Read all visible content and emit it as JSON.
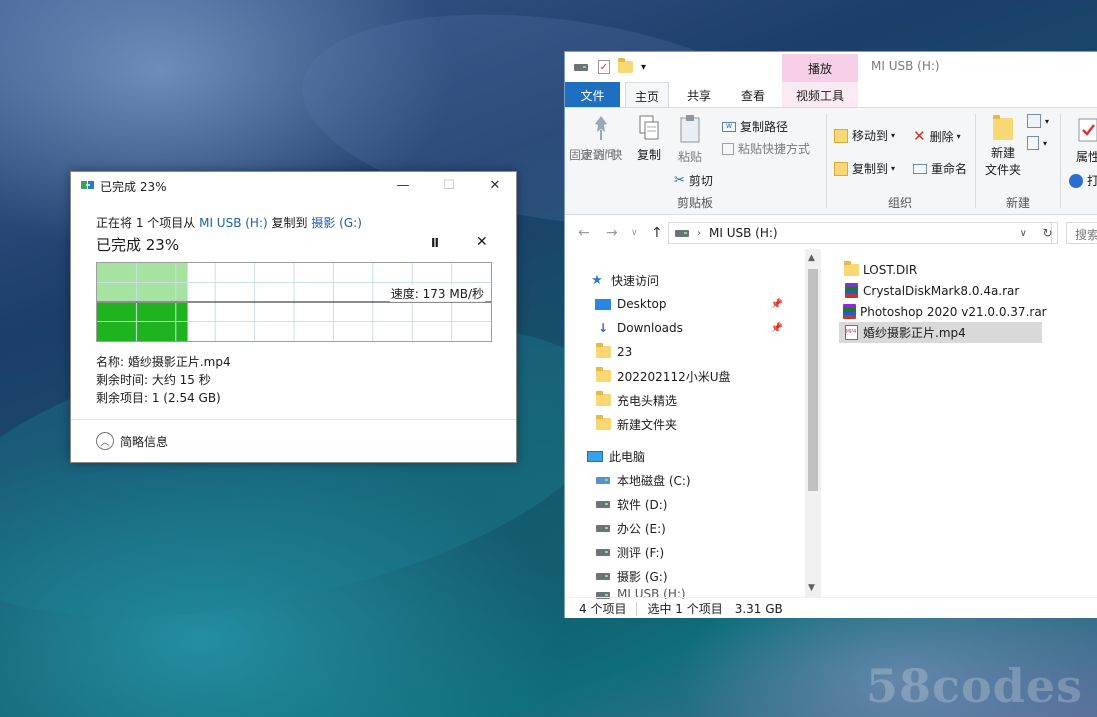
{
  "copy_dialog": {
    "title": "已完成 23%",
    "from_prefix": "正在将 1 个项目从",
    "source": "MI USB (H:)",
    "copy_to": "复制到",
    "destination": "摄影 (G:)",
    "progress_label": "已完成 23%",
    "progress_percent": 23,
    "speed": "速度: 173 MB/秒",
    "name": "名称: 婚纱摄影正片.mp4",
    "time_remaining": "剩余时间: 大约 15 秒",
    "items_remaining": "剩余项目: 1 (2.54 GB)",
    "less_details": "简略信息",
    "pause_glyph": "II",
    "cancel_glyph": "✕",
    "minimize_glyph": "—",
    "maximize_glyph": "☐",
    "close_glyph": "✕"
  },
  "explorer": {
    "title": "MI USB (H:)",
    "context_tab_header": "播放",
    "tabs": {
      "file": "文件",
      "home": "主页",
      "share": "共享",
      "view": "查看",
      "video_tools": "视频工具"
    },
    "ribbon": {
      "pin_quick_access": [
        "固定到\"快",
        "速访问\""
      ],
      "copy": "复制",
      "paste": "粘贴",
      "copy_path": "复制路径",
      "paste_shortcut": "粘贴快捷方式",
      "cut": "剪切",
      "clipboard_group": "剪贴板",
      "move_to": "移动到",
      "copy_to": "复制到",
      "delete": "删除",
      "rename": "重命名",
      "organize_group": "组织",
      "new_folder": [
        "新建",
        "文件夹"
      ],
      "new_group": "新建",
      "properties": "属性",
      "open": "打"
    },
    "address": {
      "path": "MI USB (H:)",
      "search_placeholder": "搜索"
    },
    "nav": {
      "quick_access": "快速访问",
      "desktop": "Desktop",
      "downloads": "Downloads",
      "folders": [
        "23",
        "202202112小米U盘",
        "充电头精选",
        "新建文件夹"
      ],
      "this_pc": "此电脑",
      "drives": [
        "本地磁盘 (C:)",
        "软件 (D:)",
        "办公 (E:)",
        "测评 (F:)",
        "摄影 (G:)"
      ],
      "partial_drive": "MI USB (H:)"
    },
    "files": [
      {
        "name": "LOST.DIR",
        "icon": "folder-icon"
      },
      {
        "name": "CrystalDiskMark8.0.4a.rar",
        "icon": "rar-icon"
      },
      {
        "name": "Photoshop 2020 v21.0.0.37.rar",
        "icon": "rar-icon"
      },
      {
        "name": "婚纱摄影正片.mp4",
        "icon": "mp4-icon",
        "selected": true
      }
    ],
    "status": {
      "item_count": "4 个项目",
      "selected": "选中 1 个项目",
      "size": "3.31 GB"
    }
  },
  "watermark": "58codes"
}
